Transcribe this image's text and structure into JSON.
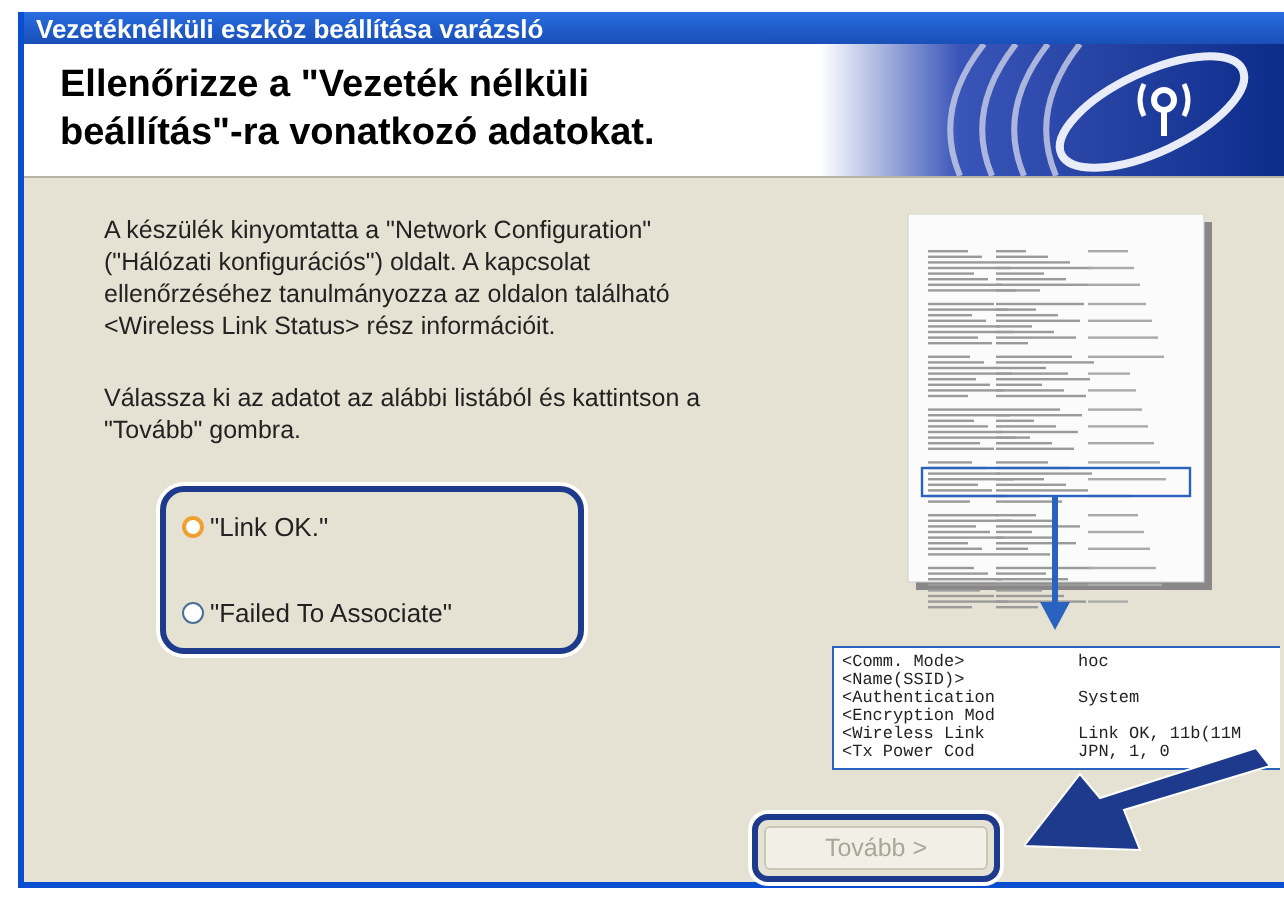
{
  "window": {
    "title": "Vezetéknélküli eszköz beállítása varázsló"
  },
  "header": {
    "title": "Ellenőrizze a \"Vezeték nélküli beállítás\"-ra vonatkozó adatokat."
  },
  "instructions": [
    "A készülék kinyomtatta a \"Network Configuration\" (\"Hálózati konfigurációs\") oldalt. A kapcsolat ellenőrzéséhez tanulmányozza az oldalon található <Wireless Link Status> rész információit.",
    "Válassza ki az adatot az alábbi listából és kattintson a \"Tovább\" gombra."
  ],
  "options": [
    {
      "label": "\"Link OK.\"",
      "selected": false,
      "hovered": true
    },
    {
      "label": "\"Failed To Associate\"",
      "selected": false,
      "hovered": false
    }
  ],
  "status_excerpt": {
    "rows": [
      {
        "label": "<Comm. Mode>",
        "value": "hoc"
      },
      {
        "label": "<Name(SSID)>"
      },
      {
        "label": "<Authentication",
        "value": "System"
      },
      {
        "label": "<Encryption Mod"
      },
      {
        "label": "<Wireless Link",
        "value": "Link OK, 11b(11M"
      },
      {
        "label": "<Tx Power Cod",
        "value": "JPN, 1, 0"
      }
    ]
  },
  "buttons": [
    {
      "label": "Tovább >",
      "disabled": true
    }
  ]
}
